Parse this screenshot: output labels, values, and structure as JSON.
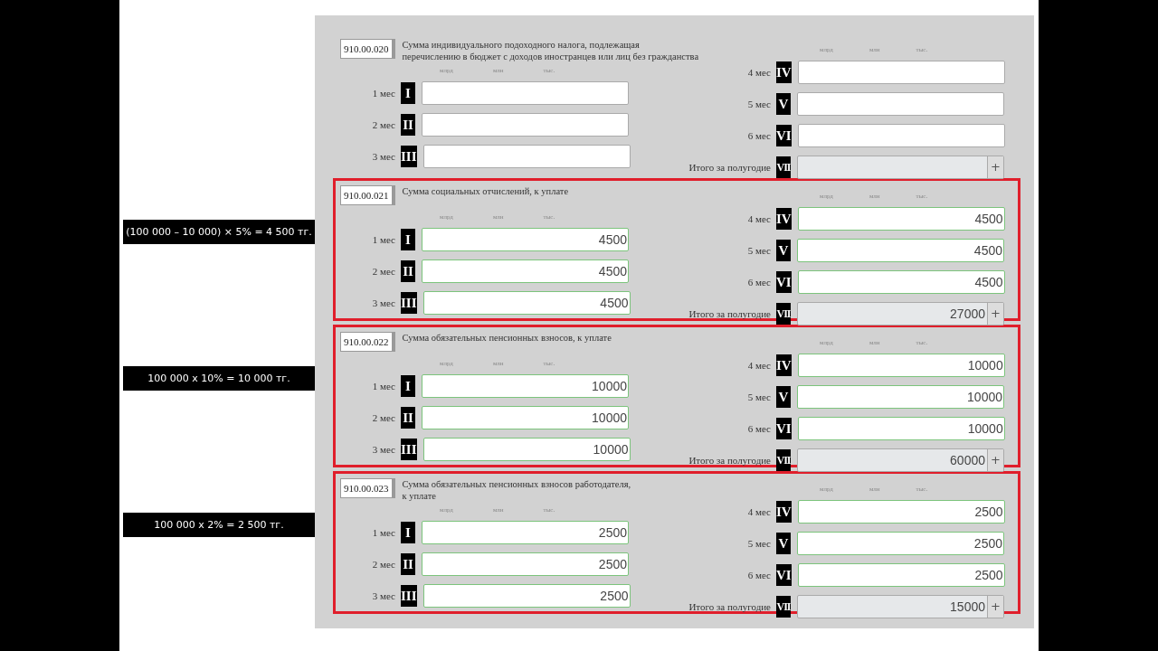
{
  "sections": [
    {
      "code": "910.00.020",
      "title_lines": [
        "Сумма индивидуального подоходного налога, подлежащая",
        "перечислению в бюджет с доходов иностранцев или лиц без гражданства"
      ],
      "highlighted": false,
      "units_left": [
        "млрд",
        "млн",
        "тыс."
      ],
      "units_right": [
        "млрд",
        "млн",
        "тыс."
      ],
      "months": [
        {
          "label": "1 мес",
          "numeral": "I"
        },
        {
          "label": "2 мес",
          "numeral": "II"
        },
        {
          "label": "3 мес",
          "numeral": "III"
        },
        {
          "label": "4 мес",
          "numeral": "IV"
        },
        {
          "label": "5 мес",
          "numeral": "V"
        },
        {
          "label": "6 мес",
          "numeral": "VI"
        }
      ],
      "total": {
        "label": "Итого за полугодие",
        "numeral": "VII",
        "button": "+"
      }
    },
    {
      "code": "910.00.021",
      "title_lines": [
        "Сумма социальных отчислений, к уплате"
      ],
      "highlighted": true,
      "note": "(100 000 – 10 000) × 5% = 4 500 тг.",
      "units_left": [
        "млрд",
        "млн",
        "тыс."
      ],
      "units_right": [
        "млрд",
        "млн",
        "тыс."
      ],
      "months": [
        {
          "label": "1 мес",
          "numeral": "I",
          "value": "4500"
        },
        {
          "label": "2 мес",
          "numeral": "II",
          "value": "4500"
        },
        {
          "label": "3 мес",
          "numeral": "III",
          "value": "4500"
        },
        {
          "label": "4 мес",
          "numeral": "IV",
          "value": "4500"
        },
        {
          "label": "5 мес",
          "numeral": "V",
          "value": "4500"
        },
        {
          "label": "6 мес",
          "numeral": "VI",
          "value": "4500"
        }
      ],
      "total": {
        "label": "Итого за полугодие",
        "numeral": "VII",
        "value": "27000",
        "button": "+"
      }
    },
    {
      "code": "910.00.022",
      "title_lines": [
        "Сумма обязательных пенсионных взносов, к уплате"
      ],
      "highlighted": true,
      "note": "100 000 x 10% = 10 000 тг.",
      "units_left": [
        "млрд",
        "млн",
        "тыс."
      ],
      "units_right": [
        "млрд",
        "млн",
        "тыс."
      ],
      "months": [
        {
          "label": "1 мес",
          "numeral": "I",
          "value": "10000"
        },
        {
          "label": "2 мес",
          "numeral": "II",
          "value": "10000"
        },
        {
          "label": "3 мес",
          "numeral": "III",
          "value": "10000"
        },
        {
          "label": "4 мес",
          "numeral": "IV",
          "value": "10000"
        },
        {
          "label": "5 мес",
          "numeral": "V",
          "value": "10000"
        },
        {
          "label": "6 мес",
          "numeral": "VI",
          "value": "10000"
        }
      ],
      "total": {
        "label": "Итого за полугодие",
        "numeral": "VII",
        "value": "60000",
        "button": "+"
      }
    },
    {
      "code": "910.00.023",
      "title_lines": [
        "Сумма обязательных пенсионных взносов работодателя,",
        "к уплате"
      ],
      "highlighted": true,
      "note": "100 000 x 2% = 2 500 тг.",
      "units_left": [
        "млрд",
        "млн",
        "тыс."
      ],
      "units_right": [
        "млрд",
        "млн",
        "тыс."
      ],
      "months": [
        {
          "label": "1 мес",
          "numeral": "I",
          "value": "2500"
        },
        {
          "label": "2 мес",
          "numeral": "II",
          "value": "2500"
        },
        {
          "label": "3 мес",
          "numeral": "III",
          "value": "2500"
        },
        {
          "label": "4 мес",
          "numeral": "IV",
          "value": "2500"
        },
        {
          "label": "5 мес",
          "numeral": "V",
          "value": "2500"
        },
        {
          "label": "6 мес",
          "numeral": "VI",
          "value": "2500"
        }
      ],
      "total": {
        "label": "Итого за полугодие",
        "numeral": "VII",
        "value": "15000",
        "button": "+"
      }
    }
  ]
}
